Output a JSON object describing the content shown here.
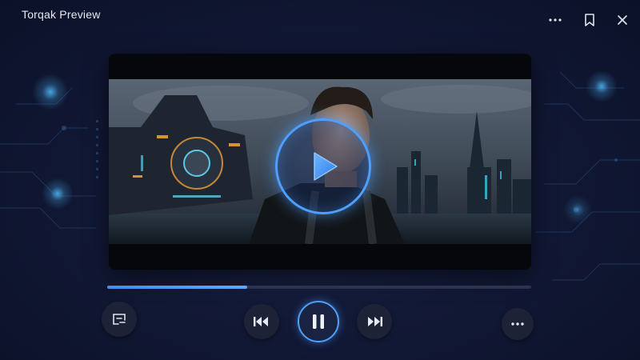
{
  "window": {
    "title": "Torqak Preview"
  },
  "titlebar": {
    "more_icon": "ellipsis-horizontal-icon",
    "bookmark_icon": "bookmark-icon",
    "close_icon": "close-icon"
  },
  "player": {
    "progress": 0.33,
    "overlay_icon": "play-icon",
    "controls": {
      "playlist_icon": "playlist-icon",
      "previous_icon": "skip-previous-icon",
      "pause_icon": "pause-icon",
      "next_icon": "skip-next-icon",
      "more_icon": "ellipsis-horizontal-icon"
    }
  },
  "colors": {
    "accent": "#4f9fff",
    "background": "#121936",
    "control_bg": "#1d2236"
  }
}
